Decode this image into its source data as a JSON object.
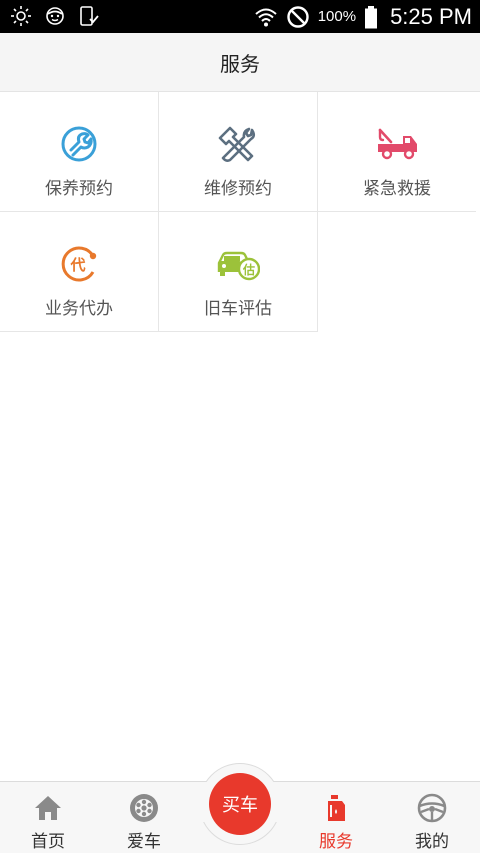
{
  "status_bar": {
    "battery_percent": "100%",
    "time": "5:25 PM",
    "icons": [
      "brightness-icon",
      "face-icon",
      "phone-check-icon",
      "wifi-icon",
      "no-disturb-icon",
      "battery-icon"
    ]
  },
  "header": {
    "title": "服务"
  },
  "services": [
    {
      "label": "保养预约",
      "icon": "maintenance-icon",
      "color": "#3aa0d8"
    },
    {
      "label": "维修预约",
      "icon": "repair-tools-icon",
      "color": "#5c6f80"
    },
    {
      "label": "紧急救援",
      "icon": "tow-truck-icon",
      "color": "#e24a6a"
    },
    {
      "label": "业务代办",
      "icon": "agent-service-icon",
      "color": "#e8792c"
    },
    {
      "label": "旧车评估",
      "icon": "used-car-evaluation-icon",
      "color": "#9cc23a"
    }
  ],
  "bottom_nav": {
    "items": [
      {
        "label": "首页",
        "icon": "home-icon"
      },
      {
        "label": "爱车",
        "icon": "wheel-icon"
      },
      {
        "label": "服务",
        "icon": "oil-bottle-icon",
        "active": true
      },
      {
        "label": "我的",
        "icon": "steering-wheel-icon"
      }
    ],
    "buy_button": "买车",
    "active_color": "#e8392c"
  }
}
